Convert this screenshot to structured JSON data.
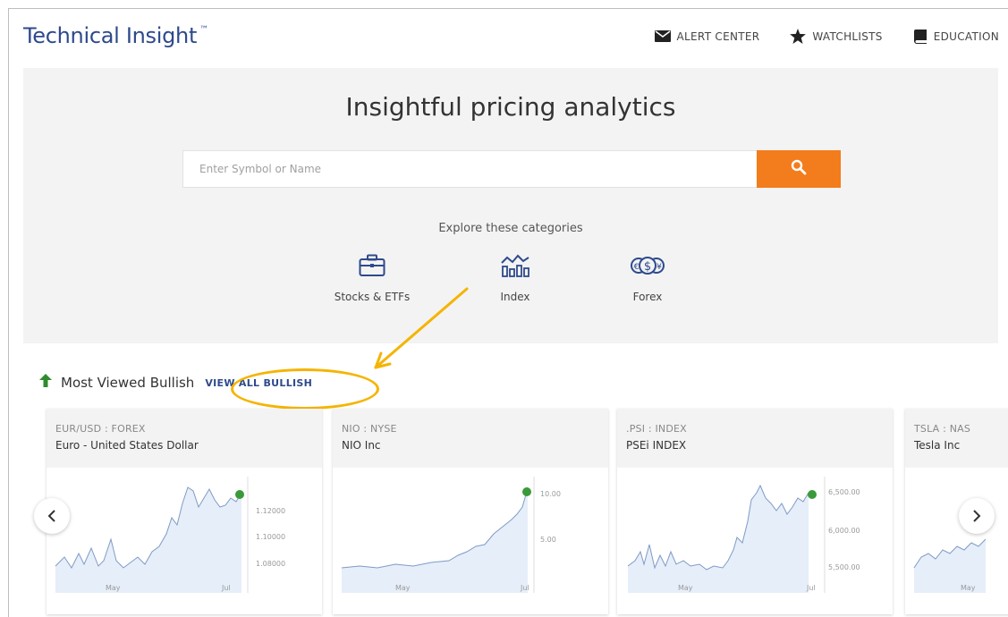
{
  "header": {
    "brand": "Technical Insight",
    "brand_mark": "™",
    "nav": [
      {
        "label": "ALERT CENTER",
        "icon": "envelope-icon"
      },
      {
        "label": "WATCHLISTS",
        "icon": "star-icon"
      },
      {
        "label": "EDUCATION",
        "icon": "book-icon"
      }
    ]
  },
  "hero": {
    "title": "Insightful pricing analytics",
    "search_placeholder": "Enter Symbol or Name",
    "explore_label": "Explore these categories",
    "categories": [
      {
        "label": "Stocks & ETFs",
        "icon": "briefcase-icon"
      },
      {
        "label": "Index",
        "icon": "chart-index-icon"
      },
      {
        "label": "Forex",
        "icon": "currency-icon"
      }
    ]
  },
  "bullish": {
    "title": "Most Viewed Bullish",
    "view_all": "VIEW ALL BULLISH"
  },
  "cards": [
    {
      "symbol": "EUR/USD : FOREX",
      "name": "Euro - United States Dollar",
      "y_ticks": [
        "1.12000",
        "1.10000",
        "1.08000"
      ],
      "x_ticks": [
        "May",
        "Jul"
      ]
    },
    {
      "symbol": "NIO : NYSE",
      "name": "NIO Inc",
      "y_ticks": [
        "10.00",
        "5.00"
      ],
      "x_ticks": [
        "May",
        "Jul"
      ]
    },
    {
      "symbol": ".PSI : INDEX",
      "name": "PSEi INDEX",
      "y_ticks": [
        "6,500.00",
        "6,000.00",
        "5,500.00"
      ],
      "x_ticks": [
        "May",
        "Jul"
      ]
    },
    {
      "symbol": "TSLA : NAS",
      "name": "Tesla Inc",
      "y_ticks": [],
      "x_ticks": [
        "May"
      ]
    }
  ],
  "colors": {
    "brand": "#2e4a8c",
    "accent": "#f37c1c",
    "highlight": "#f5b400",
    "up": "#2e8b2e"
  }
}
